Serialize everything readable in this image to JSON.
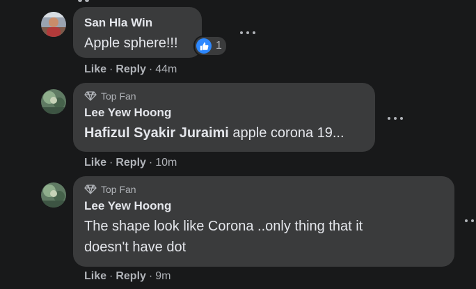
{
  "comments": [
    {
      "author": "San Hla Win",
      "text": "Apple sphere!!!",
      "reaction_count": "1",
      "actions": {
        "like": "Like",
        "reply": "Reply",
        "time": "44m"
      },
      "icons": {
        "reaction": "like-icon",
        "more": "more-options-icon"
      }
    },
    {
      "badge": "Top Fan",
      "author": "Lee Yew Hoong",
      "mention": "Hafizul Syakir Juraimi",
      "text": " apple corona 19...",
      "actions": {
        "like": "Like",
        "reply": "Reply",
        "time": "10m"
      },
      "icons": {
        "badge": "diamond-icon",
        "more": "more-options-icon"
      }
    },
    {
      "badge": "Top Fan",
      "author": "Lee Yew Hoong",
      "text_line1": "The shape look like Corona ..only thing that it",
      "text_line2": "doesn't have dot",
      "actions": {
        "like": "Like",
        "reply": "Reply",
        "time": "9m"
      },
      "icons": {
        "badge": "diamond-icon",
        "more": "more-options-icon"
      }
    }
  ],
  "colors": {
    "background": "#18191a",
    "bubble": "#3a3b3c",
    "text": "#e4e6eb",
    "secondary": "#b0b3b8",
    "like_blue": "#2d88ff"
  }
}
